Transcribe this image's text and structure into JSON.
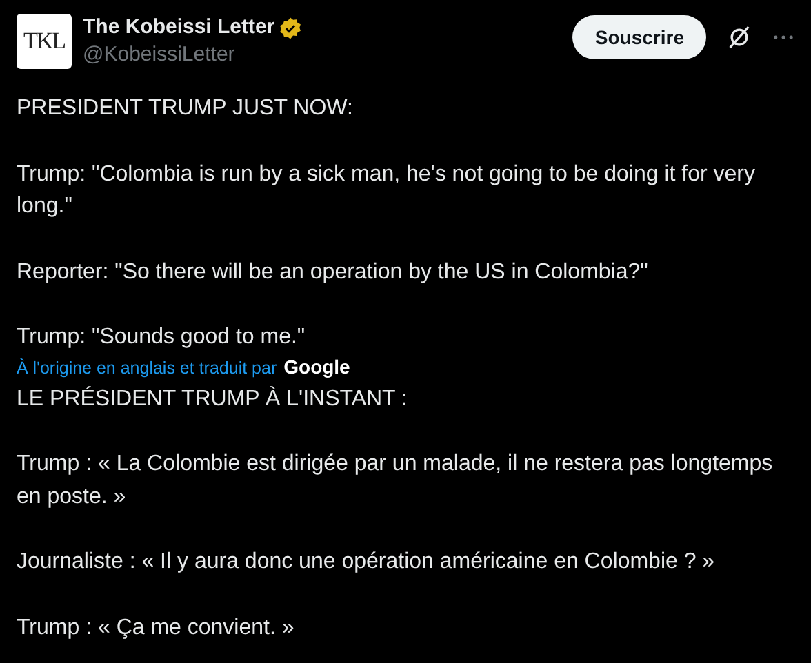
{
  "author": {
    "logo_text": "TKL",
    "name": "The Kobeissi Letter",
    "verified": true,
    "handle": "@KobeissiLetter"
  },
  "subscribe_button": "Souscrire",
  "original_text": [
    "PRESIDENT TRUMP JUST NOW:",
    "Trump: \"Colombia is run by a sick man, he's not going to be doing it for very long.\"",
    "Reporter: \"So there will be an operation by the US in Colombia?\"",
    "Trump: \"Sounds good to me.\""
  ],
  "translation_note": {
    "text": "À l'origine en anglais et traduit par",
    "provider": "Google"
  },
  "translated_text": [
    "LE PRÉSIDENT TRUMP À L'INSTANT :",
    "Trump : « La Colombie est dirigée par un malade, il ne restera pas longtemps en poste. »",
    "Journaliste : « Il y aura donc une opération américaine en Colombie ? »",
    "Trump : « Ça me convient. »"
  ]
}
